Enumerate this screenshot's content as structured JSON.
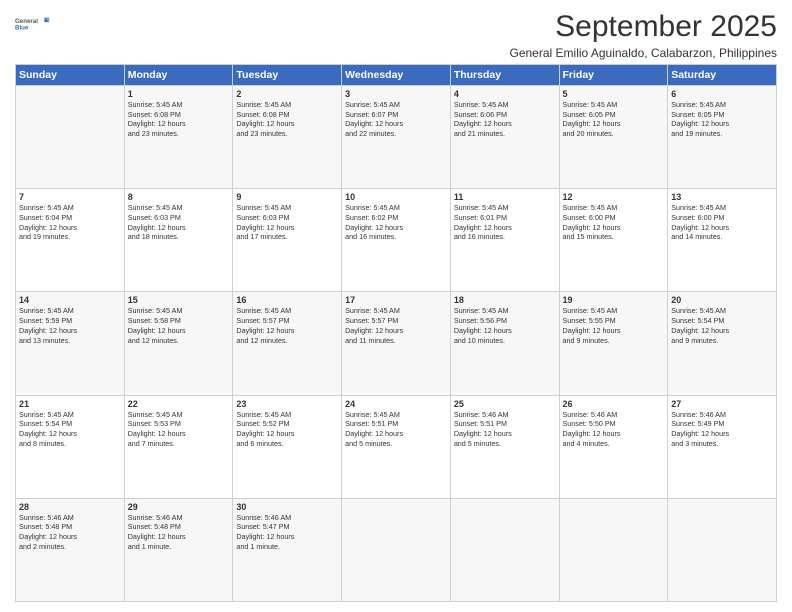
{
  "header": {
    "logo_line1": "General",
    "logo_line2": "Blue",
    "month_title": "September 2025",
    "subtitle": "General Emilio Aguinaldo, Calabarzon, Philippines"
  },
  "days_of_week": [
    "Sunday",
    "Monday",
    "Tuesday",
    "Wednesday",
    "Thursday",
    "Friday",
    "Saturday"
  ],
  "weeks": [
    [
      {
        "day": "",
        "content": ""
      },
      {
        "day": "1",
        "content": "Sunrise: 5:45 AM\nSunset: 6:08 PM\nDaylight: 12 hours\nand 23 minutes."
      },
      {
        "day": "2",
        "content": "Sunrise: 5:45 AM\nSunset: 6:08 PM\nDaylight: 12 hours\nand 23 minutes."
      },
      {
        "day": "3",
        "content": "Sunrise: 5:45 AM\nSunset: 6:07 PM\nDaylight: 12 hours\nand 22 minutes."
      },
      {
        "day": "4",
        "content": "Sunrise: 5:45 AM\nSunset: 6:06 PM\nDaylight: 12 hours\nand 21 minutes."
      },
      {
        "day": "5",
        "content": "Sunrise: 5:45 AM\nSunset: 6:05 PM\nDaylight: 12 hours\nand 20 minutes."
      },
      {
        "day": "6",
        "content": "Sunrise: 5:45 AM\nSunset: 6:05 PM\nDaylight: 12 hours\nand 19 minutes."
      }
    ],
    [
      {
        "day": "7",
        "content": "Sunrise: 5:45 AM\nSunset: 6:04 PM\nDaylight: 12 hours\nand 19 minutes."
      },
      {
        "day": "8",
        "content": "Sunrise: 5:45 AM\nSunset: 6:03 PM\nDaylight: 12 hours\nand 18 minutes."
      },
      {
        "day": "9",
        "content": "Sunrise: 5:45 AM\nSunset: 6:03 PM\nDaylight: 12 hours\nand 17 minutes."
      },
      {
        "day": "10",
        "content": "Sunrise: 5:45 AM\nSunset: 6:02 PM\nDaylight: 12 hours\nand 16 minutes."
      },
      {
        "day": "11",
        "content": "Sunrise: 5:45 AM\nSunset: 6:01 PM\nDaylight: 12 hours\nand 16 minutes."
      },
      {
        "day": "12",
        "content": "Sunrise: 5:45 AM\nSunset: 6:00 PM\nDaylight: 12 hours\nand 15 minutes."
      },
      {
        "day": "13",
        "content": "Sunrise: 5:45 AM\nSunset: 6:00 PM\nDaylight: 12 hours\nand 14 minutes."
      }
    ],
    [
      {
        "day": "14",
        "content": "Sunrise: 5:45 AM\nSunset: 5:59 PM\nDaylight: 12 hours\nand 13 minutes."
      },
      {
        "day": "15",
        "content": "Sunrise: 5:45 AM\nSunset: 5:58 PM\nDaylight: 12 hours\nand 12 minutes."
      },
      {
        "day": "16",
        "content": "Sunrise: 5:45 AM\nSunset: 5:57 PM\nDaylight: 12 hours\nand 12 minutes."
      },
      {
        "day": "17",
        "content": "Sunrise: 5:45 AM\nSunset: 5:57 PM\nDaylight: 12 hours\nand 11 minutes."
      },
      {
        "day": "18",
        "content": "Sunrise: 5:45 AM\nSunset: 5:56 PM\nDaylight: 12 hours\nand 10 minutes."
      },
      {
        "day": "19",
        "content": "Sunrise: 5:45 AM\nSunset: 5:55 PM\nDaylight: 12 hours\nand 9 minutes."
      },
      {
        "day": "20",
        "content": "Sunrise: 5:45 AM\nSunset: 5:54 PM\nDaylight: 12 hours\nand 9 minutes."
      }
    ],
    [
      {
        "day": "21",
        "content": "Sunrise: 5:45 AM\nSunset: 5:54 PM\nDaylight: 12 hours\nand 8 minutes."
      },
      {
        "day": "22",
        "content": "Sunrise: 5:45 AM\nSunset: 5:53 PM\nDaylight: 12 hours\nand 7 minutes."
      },
      {
        "day": "23",
        "content": "Sunrise: 5:45 AM\nSunset: 5:52 PM\nDaylight: 12 hours\nand 6 minutes."
      },
      {
        "day": "24",
        "content": "Sunrise: 5:45 AM\nSunset: 5:51 PM\nDaylight: 12 hours\nand 5 minutes."
      },
      {
        "day": "25",
        "content": "Sunrise: 5:46 AM\nSunset: 5:51 PM\nDaylight: 12 hours\nand 5 minutes."
      },
      {
        "day": "26",
        "content": "Sunrise: 5:46 AM\nSunset: 5:50 PM\nDaylight: 12 hours\nand 4 minutes."
      },
      {
        "day": "27",
        "content": "Sunrise: 5:46 AM\nSunset: 5:49 PM\nDaylight: 12 hours\nand 3 minutes."
      }
    ],
    [
      {
        "day": "28",
        "content": "Sunrise: 5:46 AM\nSunset: 5:48 PM\nDaylight: 12 hours\nand 2 minutes."
      },
      {
        "day": "29",
        "content": "Sunrise: 5:46 AM\nSunset: 5:48 PM\nDaylight: 12 hours\nand 1 minute."
      },
      {
        "day": "30",
        "content": "Sunrise: 5:46 AM\nSunset: 5:47 PM\nDaylight: 12 hours\nand 1 minute."
      },
      {
        "day": "",
        "content": ""
      },
      {
        "day": "",
        "content": ""
      },
      {
        "day": "",
        "content": ""
      },
      {
        "day": "",
        "content": ""
      }
    ]
  ]
}
